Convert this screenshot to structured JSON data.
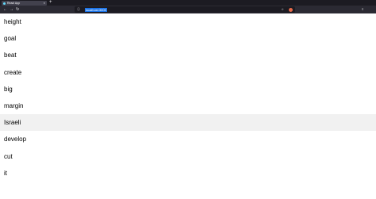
{
  "browser": {
    "tab_title": "React App",
    "tab_close": "×",
    "new_tab": "+",
    "back": "←",
    "forward": "→",
    "reload": "↻",
    "address": "localhost:3000",
    "lock_icon": "ⓘ",
    "star_icon": "☆",
    "menu_icon": "≡"
  },
  "list": {
    "items": [
      "height",
      "goal",
      "beat",
      "create",
      "big",
      "margin",
      "Israeli",
      "develop",
      "cut",
      "it"
    ],
    "hovered_index": 6
  },
  "colors": {
    "chrome_bg": "#1c1b22",
    "toolbar_bg": "#2b2a33",
    "url_highlight": "#1a73e8",
    "hover_bg": "#f1f1f1"
  }
}
